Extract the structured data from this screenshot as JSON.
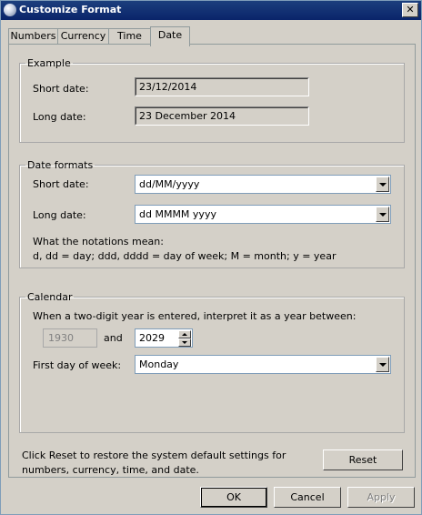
{
  "window": {
    "title": "Customize Format",
    "close_glyph": "✕"
  },
  "tabs": [
    {
      "label": "Numbers"
    },
    {
      "label": "Currency"
    },
    {
      "label": "Time"
    },
    {
      "label": "Date"
    }
  ],
  "example": {
    "group_label": "Example",
    "short_label": "Short date:",
    "short_value": "23/12/2014",
    "long_label": "Long date:",
    "long_value": "23 December 2014"
  },
  "formats": {
    "group_label": "Date formats",
    "short_label": "Short date:",
    "short_value": "dd/MM/yyyy",
    "long_label": "Long date:",
    "long_value": "dd MMMM yyyy",
    "notation_title": "What the notations mean:",
    "notation_text": "d, dd = day;  ddd, dddd = day of week;  M = month;  y = year"
  },
  "calendar": {
    "group_label": "Calendar",
    "two_digit_text": "When a two-digit year is entered, interpret it as a year between:",
    "year_from": "1930",
    "and_label": "and",
    "year_to": "2029",
    "first_day_label": "First day of week:",
    "first_day_value": "Monday"
  },
  "footer": {
    "reset_text_line1": "Click Reset to restore the system default settings for",
    "reset_text_line2": "numbers, currency, time, and date.",
    "reset_button": "Reset"
  },
  "buttons": {
    "ok": "OK",
    "cancel": "Cancel",
    "apply": "Apply"
  }
}
